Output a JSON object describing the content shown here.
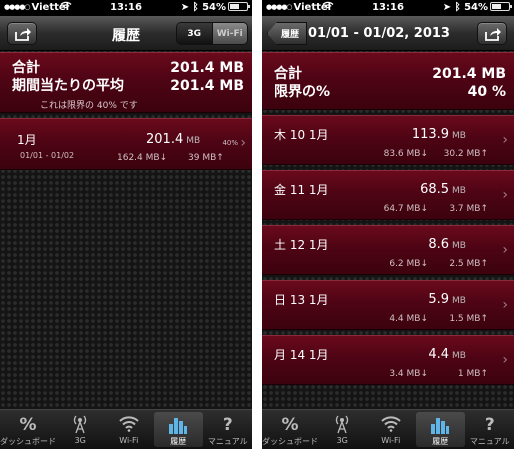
{
  "status_bar": {
    "carrier": "Viettel",
    "time": "13:16",
    "battery": "54%",
    "battery_level": 0.54
  },
  "left": {
    "title": "履歴",
    "segment": {
      "option_3g": "3G",
      "option_wifi": "Wi-Fi",
      "selected": "3G"
    },
    "summary": {
      "total_label": "合計",
      "total_value": "201.4 MB",
      "avg_label": "期間当たりの平均",
      "avg_value": "201.4 MB",
      "note": "これは限界の 40% です"
    },
    "month": {
      "label": "1月",
      "range": "01/01 - 01/02",
      "total": "201.4",
      "unit": "MB",
      "percent": "40%",
      "down": "162.4 MB↓",
      "up": "39 MB↑"
    }
  },
  "right": {
    "back_label": "履歴",
    "title": "01/01 - 01/02, 2013",
    "summary": {
      "total_label": "合計",
      "total_value": "201.4 MB",
      "limit_label": "限界の%",
      "limit_value": "40 %"
    },
    "days": [
      {
        "label": "木 10 1月",
        "total": "113.9",
        "unit": "MB",
        "down": "83.6 MB↓",
        "up": "30.2 MB↑"
      },
      {
        "label": "金 11 1月",
        "total": "68.5",
        "unit": "MB",
        "down": "64.7 MB↓",
        "up": "3.7 MB↑"
      },
      {
        "label": "土 12 1月",
        "total": "8.6",
        "unit": "MB",
        "down": "6.2 MB↓",
        "up": "2.5 MB↑"
      },
      {
        "label": "日 13 1月",
        "total": "5.9",
        "unit": "MB",
        "down": "4.4 MB↓",
        "up": "1.5 MB↑"
      },
      {
        "label": "月 14 1月",
        "total": "4.4",
        "unit": "MB",
        "down": "3.4 MB↓",
        "up": "1 MB↑"
      }
    ]
  },
  "tabs": [
    {
      "label": "ダッシュボード",
      "icon": "percent-icon",
      "glyph": "%"
    },
    {
      "label": "3G",
      "icon": "antenna-icon",
      "glyph": ""
    },
    {
      "label": "Wi-Fi",
      "icon": "wifi-icon",
      "glyph": ""
    },
    {
      "label": "履歴",
      "icon": "bar-chart-icon",
      "glyph": "",
      "active": true
    },
    {
      "label": "マニュアル",
      "icon": "question-icon",
      "glyph": "?"
    }
  ],
  "colors": {
    "wood": "#4e0414",
    "accent": "#5fb4e8"
  }
}
